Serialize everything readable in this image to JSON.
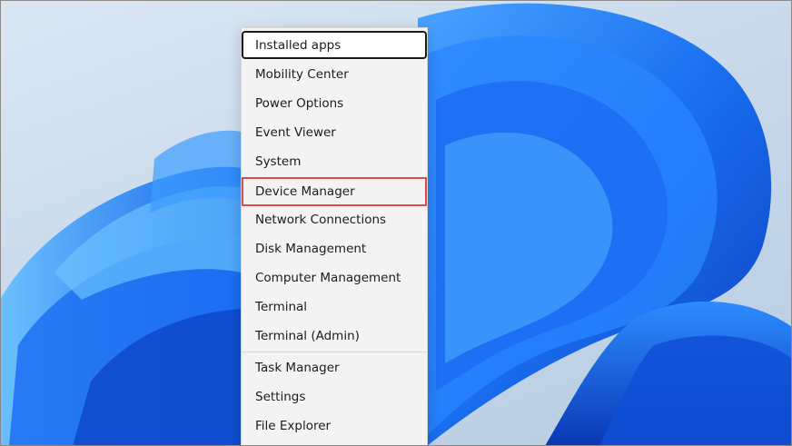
{
  "colors": {
    "menu_background": "#f3f3f3",
    "highlight_border": "#e04a4a",
    "focus_border": "#1b1b1b",
    "wallpaper_bloom": "#1a6ff0"
  },
  "context_menu": {
    "items": [
      {
        "label": "Installed apps",
        "state": "focused"
      },
      {
        "label": "Mobility Center"
      },
      {
        "label": "Power Options"
      },
      {
        "label": "Event Viewer"
      },
      {
        "label": "System"
      },
      {
        "label": "Device Manager",
        "state": "highlighted"
      },
      {
        "label": "Network Connections"
      },
      {
        "label": "Disk Management"
      },
      {
        "label": "Computer Management"
      },
      {
        "label": "Terminal"
      },
      {
        "label": "Terminal (Admin)"
      },
      {
        "label": "Task Manager"
      },
      {
        "label": "Settings"
      },
      {
        "label": "File Explorer"
      }
    ]
  }
}
